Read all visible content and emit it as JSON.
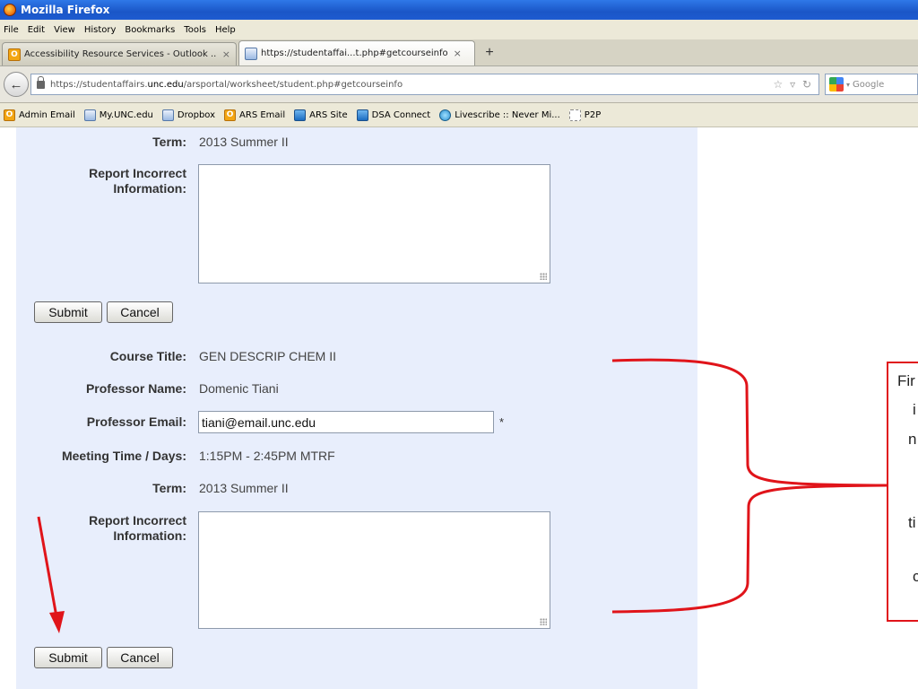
{
  "window": {
    "title": "Mozilla Firefox"
  },
  "menu": [
    "File",
    "Edit",
    "View",
    "History",
    "Bookmarks",
    "Tools",
    "Help"
  ],
  "tabs": [
    {
      "label": "Accessibility Resource Services - Outlook ...",
      "close": "×"
    },
    {
      "label": "https://studentaffai...t.php#getcourseinfo",
      "close": "×"
    }
  ],
  "new_tab": "+",
  "address": {
    "prefix": "https://studentaffairs.",
    "host": "unc.edu",
    "path": "/arsportal/worksheet/student.php#getcourseinfo"
  },
  "search": {
    "placeholder": "Google"
  },
  "bookmarks": [
    "Admin Email",
    "My.UNC.edu",
    "Dropbox",
    "ARS Email",
    "ARS Site",
    "DSA Connect",
    "Livescribe :: Never Mi...",
    "P2P"
  ],
  "form": {
    "section1": {
      "term_label": "Term:",
      "term_value": "2013 Summer II",
      "report_label_1": "Report Incorrect",
      "report_label_2": "Information:"
    },
    "section2": {
      "course_title_label": "Course Title:",
      "course_title_value": "GEN DESCRIP CHEM II",
      "professor_name_label": "Professor Name:",
      "professor_name_value": "Domenic Tiani",
      "professor_email_label": "Professor Email:",
      "professor_email_value": "tiani@email.unc.edu",
      "required_mark": "*",
      "meeting_label": "Meeting Time / Days:",
      "meeting_value": "1:15PM - 2:45PM MTRF",
      "term_label": "Term:",
      "term_value": "2013 Summer II",
      "report_label_1": "Report Incorrect",
      "report_label_2": "Information:"
    },
    "submit_label": "Submit",
    "cancel_label": "Cancel"
  },
  "callout": {
    "fragments": [
      "Fir",
      "i",
      "n",
      "ti",
      "c"
    ]
  },
  "colors": {
    "annotation_red": "#e0141a",
    "panel_bg": "#e8eefc"
  }
}
